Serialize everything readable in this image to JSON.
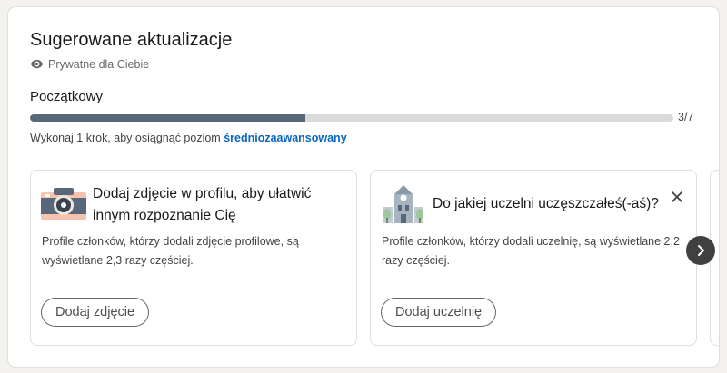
{
  "section": {
    "title": "Sugerowane aktualizacje",
    "privacy_label": "Prywatne dla Ciebie"
  },
  "progress": {
    "level": "Początkowy",
    "completed": 3,
    "total": 7,
    "fraction": 0.4286,
    "count_label": "3/7",
    "hint_prefix": "Wykonaj 1 krok, aby osiągnąć poziom ",
    "hint_link": "średniozaawansowany"
  },
  "suggestions": [
    {
      "icon": "camera-icon",
      "headline": "Dodaj zdjęcie w profilu, aby ułatwić innym rozpoznanie Cię",
      "description": "Profile członków, którzy dodali zdjęcie profilowe, są wyświetlane 2,3 razy częściej.",
      "button": "Dodaj zdjęcie"
    },
    {
      "icon": "school-icon",
      "headline": "Do jakiej uczelni uczęszczałeś(-aś)?",
      "description": "Profile członków, którzy dodali uczelnię, są wyświetlane 2,2 razy częściej.",
      "button": "Dodaj uczelnię"
    }
  ],
  "colors": {
    "progress_fill": "#56687a",
    "link": "#0a66c2",
    "arrow_bg": "#404040"
  }
}
